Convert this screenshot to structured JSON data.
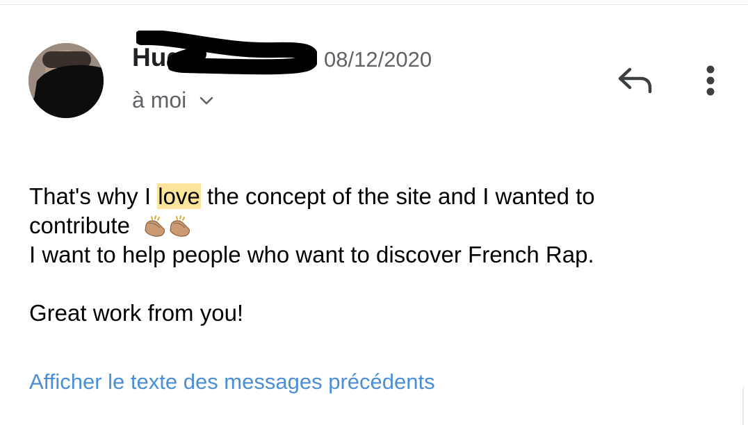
{
  "email": {
    "sender_name_visible": "Hug",
    "date": "08/12/2020",
    "recipient": "à moi",
    "body": {
      "line1_before": "That's why I ",
      "line1_highlight": "love",
      "line1_after": " the concept of the site and I wanted to",
      "line2": "contribute",
      "line3": "I want to help people who want to discover French Rap.",
      "line4": "Great work from you!"
    },
    "show_previous_link": "Afficher le texte des messages précédents"
  },
  "icons": {
    "reply": "reply-icon",
    "more": "more-vert-icon",
    "expand": "chevron-down-icon",
    "clap": "clapping-hands-emoji"
  },
  "colors": {
    "highlight": "#fce49a",
    "link": "#4a8fd6",
    "secondary_text": "#5f6368"
  }
}
